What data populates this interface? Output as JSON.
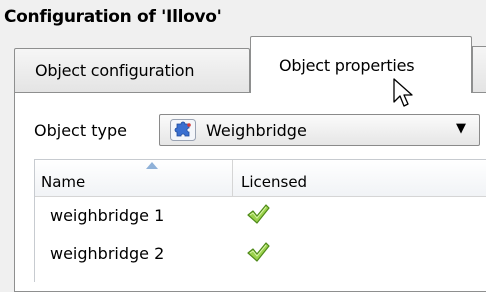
{
  "window": {
    "title": "Configuration of 'Illovo'"
  },
  "tabs": [
    {
      "label": "Object configuration",
      "active": false
    },
    {
      "label": "Object properties",
      "active": true
    }
  ],
  "object_type": {
    "label": "Object type",
    "selected": "Weighbridge",
    "icon": "puzzle-icon"
  },
  "table": {
    "columns": [
      "Name",
      "Licensed"
    ],
    "sort_column": "Name",
    "sort_direction": "ascending",
    "rows": [
      {
        "name": "weighbridge 1",
        "licensed": true,
        "licensed_icon": "green-check-icon"
      },
      {
        "name": "weighbridge 2",
        "licensed": true,
        "licensed_icon": "green-check-icon"
      }
    ]
  },
  "colors": {
    "check_green": "#6ab02c",
    "puzzle_blue": "#3a6fd0",
    "border": "#8e8f8f",
    "panel_bg": "#ffffff",
    "window_bg": "#f0f0f0"
  }
}
